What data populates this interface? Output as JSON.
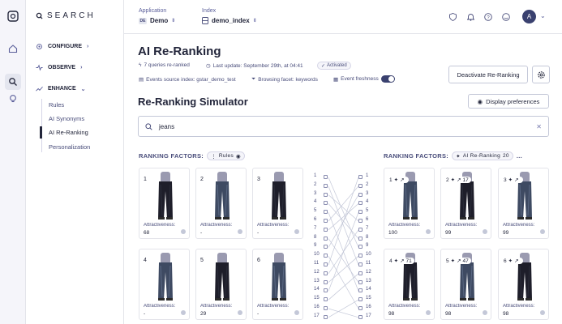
{
  "brand": {
    "name": "SEARCH"
  },
  "sidebar": {
    "sections": [
      {
        "label": "CONFIGURE",
        "icon": "gear-icon"
      },
      {
        "label": "OBSERVE",
        "icon": "pulse-icon"
      },
      {
        "label": "ENHANCE",
        "icon": "trend-icon"
      }
    ],
    "items": [
      "Rules",
      "AI Synonyms",
      "AI Re-Ranking",
      "Personalization"
    ],
    "current": "AI Re-Ranking"
  },
  "topbar": {
    "application_label": "Application",
    "application_value": "Demo",
    "application_tag": "DE",
    "index_label": "Index",
    "index_value": "demo_index",
    "avatar_initial": "A"
  },
  "page": {
    "title": "AI Re-Ranking",
    "queries_reranked": "7 queries re-ranked",
    "last_update": "Last update: September 29th, at 04:41",
    "status": "Activated",
    "events_source": "Events source index: gstar_demo_test",
    "browsing_facet": "Browsing facet: keywords",
    "events_freshness": "Event freshness",
    "deactivate_label": "Deactivate Re-Ranking"
  },
  "simulator": {
    "title": "Re-Ranking Simulator",
    "display_prefs_label": "Display preferences",
    "search_value": "jeans",
    "left_heading": "RANKING FACTORS:",
    "left_chip": "Rules",
    "right_heading": "RANKING FACTORS:",
    "right_chip": "AI Re-Ranking",
    "right_chip_count": "20",
    "right_more": "...",
    "attr_label": "Attractiveness:"
  },
  "left_cards": [
    {
      "rank": "1",
      "value": "68"
    },
    {
      "rank": "2",
      "value": "-"
    },
    {
      "rank": "3",
      "value": "-"
    },
    {
      "rank": "4",
      "value": "-"
    },
    {
      "rank": "5",
      "value": "29"
    },
    {
      "rank": "6",
      "value": "-"
    }
  ],
  "right_cards": [
    {
      "rank": "1",
      "move": "",
      "value": "100"
    },
    {
      "rank": "2",
      "move": "17",
      "value": "99"
    },
    {
      "rank": "3",
      "move": "",
      "value": "99"
    },
    {
      "rank": "4",
      "move": "71",
      "value": "98"
    },
    {
      "rank": "5",
      "move": "47",
      "value": "98"
    },
    {
      "rank": "6",
      "move": "",
      "value": "98"
    }
  ],
  "mapping_left": [
    "1",
    "2",
    "3",
    "4",
    "5",
    "6",
    "7",
    "8",
    "9",
    "10",
    "11",
    "12",
    "13",
    "14",
    "15",
    "16",
    "17"
  ],
  "mapping_right": [
    "1",
    "2",
    "3",
    "4",
    "5",
    "6",
    "7",
    "8",
    "9",
    "10",
    "11",
    "12",
    "13",
    "14",
    "15",
    "16",
    "17"
  ],
  "colors": {
    "primary": "#3a416f",
    "text": "#23263b",
    "border": "#e3e4ea"
  }
}
